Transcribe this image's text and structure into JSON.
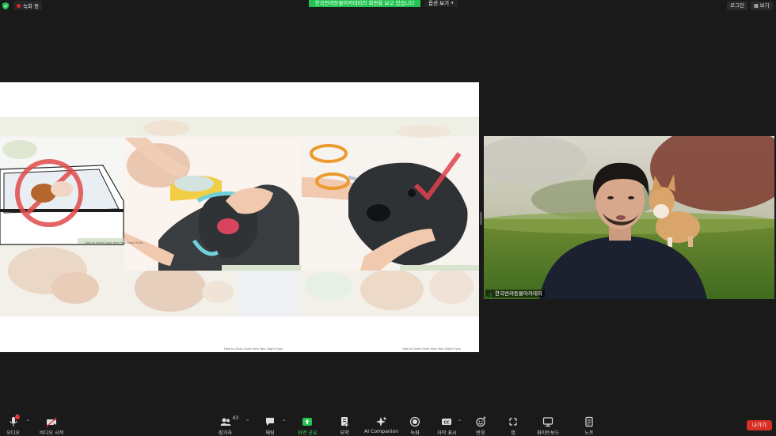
{
  "topbar": {
    "recording_label": "녹화 중",
    "share_banner": "한국반려동물아카데미의 화면을 보고 있습니다",
    "view_options_label": "옵션 보기",
    "login_label": "로그인",
    "view_label": "보기"
  },
  "shared_screen": {
    "captions": [
      "How to Clean Gunk from Your Dog's Eyes",
      "How to Clean Gunk from Your Dog's Eyes",
      "How to Clean Gunk from Your Dog's Eyes"
    ]
  },
  "camera": {
    "participant_name": "한국반려동물아카데미"
  },
  "toolbar": {
    "audio_label": "오디오",
    "video_label": "비디오 시작",
    "participants_label": "참가자",
    "participants_count": "43",
    "chat_label": "채팅",
    "share_label": "화면 공유",
    "summary_label": "요약",
    "ai_label": "AI Companion",
    "record_label": "녹화",
    "captions_label": "자막 표시",
    "reactions_label": "반응",
    "apps_label": "앱",
    "whiteboard_label": "화이트보드",
    "notes_label": "노트",
    "leave_label": "나가기"
  },
  "colors": {
    "background": "#1a1a1a",
    "share_green": "#23c552",
    "leave_red": "#d93025",
    "rec_red": "#e02828"
  },
  "icons": [
    "shield-icon",
    "mic-icon",
    "video-off-icon",
    "participants-icon",
    "chat-icon",
    "share-screen-icon",
    "summary-icon",
    "ai-spark-icon",
    "record-icon",
    "cc-icon",
    "reaction-icon",
    "apps-icon",
    "whiteboard-icon",
    "notes-icon",
    "signal-icon"
  ]
}
